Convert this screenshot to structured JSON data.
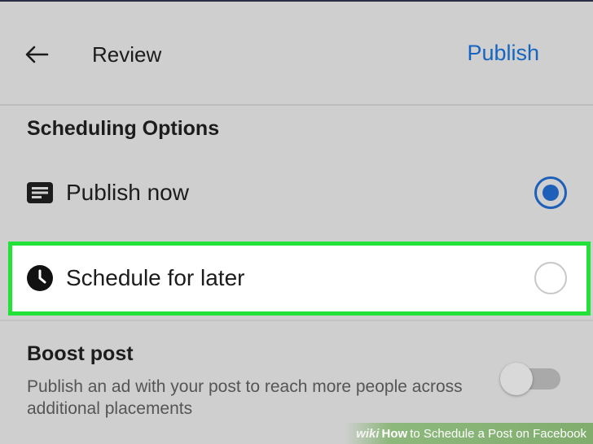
{
  "header": {
    "back_icon": "arrow-left-icon",
    "title": "Review",
    "publish_label": "Publish"
  },
  "scheduling": {
    "section_title": "Scheduling Options",
    "options": [
      {
        "label": "Publish now",
        "icon": "post-list-icon",
        "selected": true
      },
      {
        "label": "Schedule for later",
        "icon": "clock-icon",
        "selected": false
      }
    ]
  },
  "boost": {
    "title": "Boost post",
    "description": "Publish an ad with your post to reach more people across additional placements",
    "enabled": false
  },
  "watermark": {
    "brand": "wiki",
    "bold": "How",
    "rest": "to Schedule a Post on Facebook"
  },
  "colors": {
    "accent": "#1565c0",
    "highlight": "#22e23a",
    "background": "#cfcfcf"
  }
}
